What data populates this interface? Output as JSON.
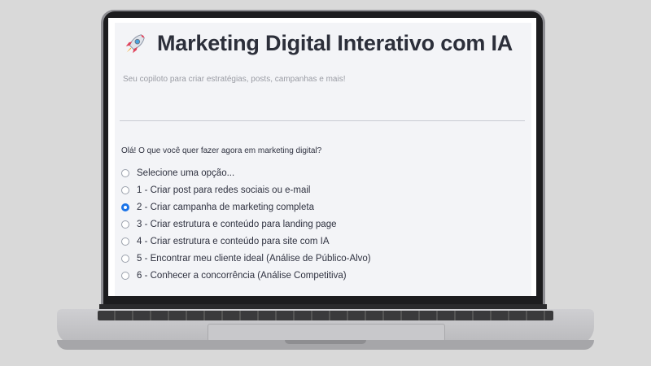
{
  "app": {
    "title": "Marketing Digital Interativo com IA",
    "subtitle": "Seu copiloto para criar estratégias, posts, campanhas e mais!",
    "title_icon": "rocket-icon"
  },
  "prompt": {
    "question": "Olá! O que você quer fazer agora em marketing digital?",
    "selected_index": 2,
    "options": [
      {
        "label": "Selecione uma opção..."
      },
      {
        "label": "1 - Criar post para redes sociais ou e-mail"
      },
      {
        "label": "2 - Criar campanha de marketing completa"
      },
      {
        "label": "3 - Criar estrutura e conteúdo para landing page"
      },
      {
        "label": "4 - Criar estrutura e conteúdo para site com IA"
      },
      {
        "label": "5 - Encontrar meu cliente ideal (Análise de Público-Alvo)"
      },
      {
        "label": "6 - Conhecer a concorrência (Análise Competitiva)"
      }
    ]
  },
  "colors": {
    "accent": "#1a73e8",
    "background": "#f3f4f7",
    "text": "#2f3240"
  }
}
